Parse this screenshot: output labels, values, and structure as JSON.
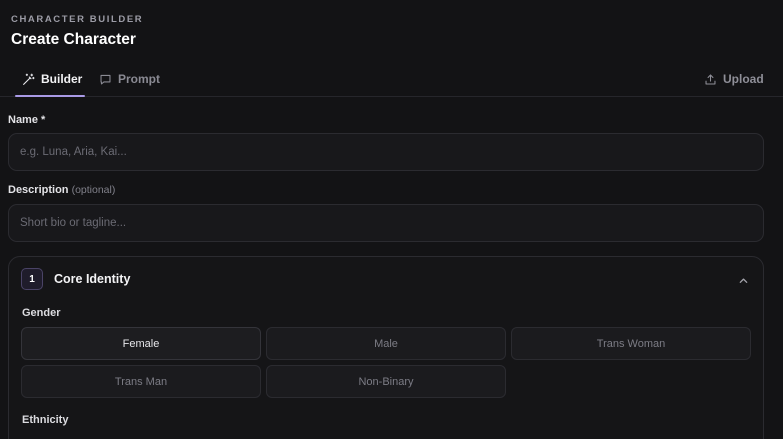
{
  "header": {
    "eyebrow": "CHARACTER BUILDER",
    "title": "Create Character"
  },
  "tabs": [
    {
      "label": "Builder",
      "icon": "magic-wand-icon",
      "active": true
    },
    {
      "label": "Prompt",
      "icon": "message-square-icon",
      "active": false
    }
  ],
  "upload": {
    "label": "Upload",
    "icon": "upload-icon"
  },
  "name_field": {
    "label": "Name",
    "required_mark": "*",
    "placeholder": "e.g. Luna, Aria, Kai...",
    "value": ""
  },
  "description_field": {
    "label": "Description",
    "optional_note": "(optional)",
    "placeholder": "Short bio or tagline...",
    "value": ""
  },
  "core_identity": {
    "step": "1",
    "title": "Core Identity",
    "expanded": true,
    "gender_label": "Gender",
    "gender_options": [
      {
        "label": "Female",
        "selected": true
      },
      {
        "label": "Male",
        "selected": false
      },
      {
        "label": "Trans Woman",
        "selected": false
      },
      {
        "label": "Trans Man",
        "selected": false
      },
      {
        "label": "Non-Binary",
        "selected": false
      }
    ],
    "ethnicity_label": "Ethnicity"
  },
  "colors": {
    "accent": "#a99ae6",
    "background": "#131315",
    "surface": "#18181b",
    "border": "#2b2b30"
  }
}
